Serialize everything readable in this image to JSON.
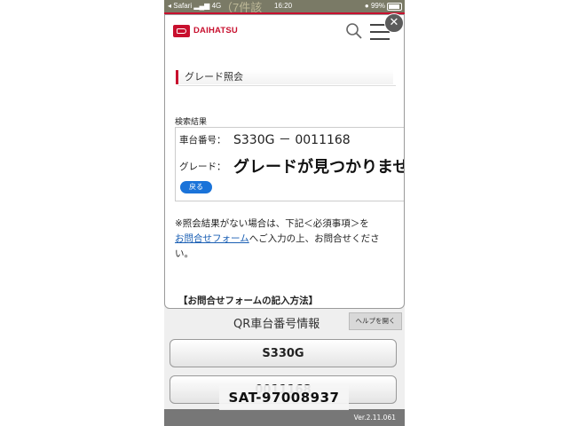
{
  "status_bar": {
    "carrier": "◂ Safari",
    "network": "4G",
    "time": "16:20",
    "battery": "99%",
    "behind_text": "（7件該"
  },
  "header": {
    "brand": "DAIHATSU",
    "accent_color": "#c8102e"
  },
  "section_title": "グレード照会",
  "results": {
    "label": "検索結果",
    "chassis_label": "車台番号：",
    "chassis_value": "S330G － 0011168",
    "grade_label": "グレード：",
    "grade_value": "グレードが見つかりませんでした",
    "back_button": "戻る"
  },
  "notice": {
    "line1": "※照会結果がない場合は、下記＜必須事項＞を",
    "link": "お問合せフォーム",
    "line2": "へご入力の上、お問合せください。"
  },
  "howto_title": "【お問合せフォームの記入方法】",
  "qr": {
    "title": "QR車台番号情報",
    "help_button": "ヘルプを開く",
    "button1": "S330G",
    "button2": "0011168"
  },
  "version": "Ver.2.11.061",
  "overlay_label": "SAT-97008937"
}
